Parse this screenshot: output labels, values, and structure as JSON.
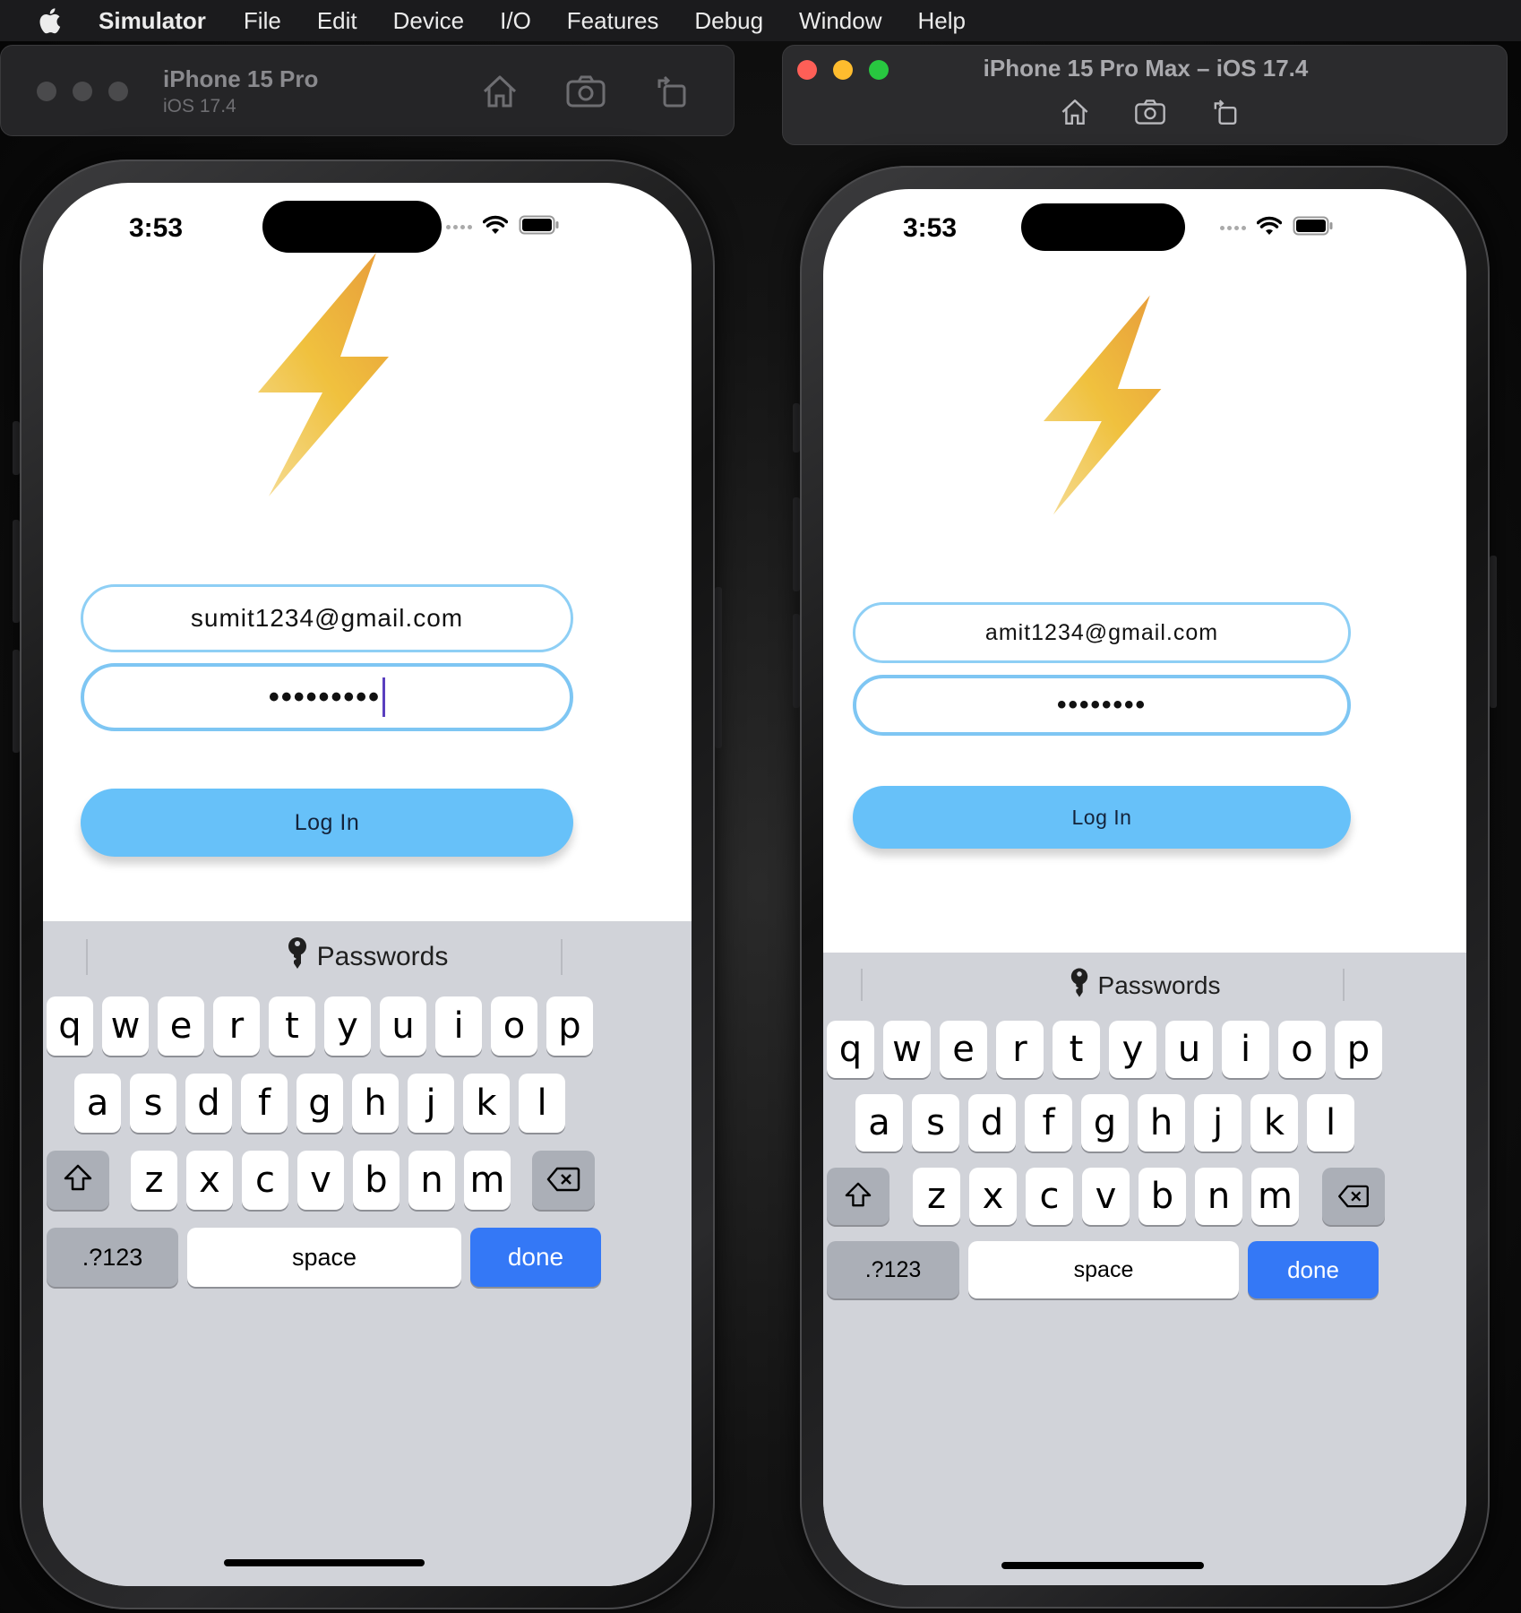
{
  "menubar": {
    "app": "Simulator",
    "items": [
      "File",
      "Edit",
      "Device",
      "I/O",
      "Features",
      "Debug",
      "Window",
      "Help"
    ]
  },
  "left_window": {
    "device": "iPhone 15 Pro",
    "os": "iOS 17.4",
    "status_time": "3:53",
    "email": "sumit1234@gmail.com",
    "password_mask": "•••••••••",
    "login_label": "Log In",
    "passwords_label": "Passwords"
  },
  "right_window": {
    "title": "iPhone 15 Pro Max – iOS 17.4",
    "status_time": "3:53",
    "email": "amit1234@gmail.com",
    "password_mask": "••••••••",
    "login_label": "Log In",
    "passwords_label": "Passwords"
  },
  "keyboard": {
    "row1": [
      "q",
      "w",
      "e",
      "r",
      "t",
      "y",
      "u",
      "i",
      "o",
      "p"
    ],
    "row2": [
      "a",
      "s",
      "d",
      "f",
      "g",
      "h",
      "j",
      "k",
      "l"
    ],
    "row3": [
      "z",
      "x",
      "c",
      "v",
      "b",
      "n",
      "m"
    ],
    "numbers_label": ".?123",
    "space_label": "space",
    "done_label": "done"
  },
  "colors": {
    "login_button": "#67c1f9",
    "field_border": "#8ecff5",
    "done_key": "#3478f6",
    "bolt_top": "#e8a23a",
    "bolt_bottom": "#f4d580"
  },
  "icons": [
    "apple-logo-icon",
    "home-icon",
    "screenshot-icon",
    "rotate-icon",
    "wifi-icon",
    "battery-icon",
    "key-icon",
    "shift-icon",
    "delete-icon",
    "lightning-bolt-icon"
  ]
}
